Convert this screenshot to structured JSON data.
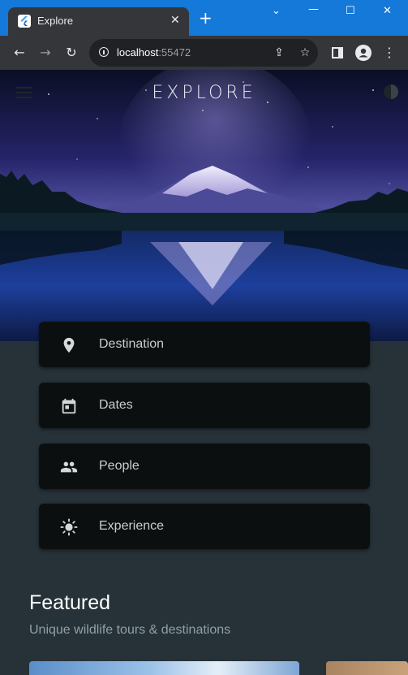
{
  "browser": {
    "tab_title": "Explore",
    "url_host": "localhost",
    "url_port": ":55472",
    "icons": [
      "flutter-logo",
      "close",
      "plus",
      "minimize",
      "maximize",
      "close",
      "back-arrow",
      "forward-arrow",
      "reload",
      "info",
      "share",
      "star",
      "sidebar",
      "profile",
      "kebab"
    ]
  },
  "app": {
    "title": "EXPLORE",
    "options": [
      {
        "label": "Destination",
        "icon": "location-pin-icon"
      },
      {
        "label": "Dates",
        "icon": "calendar-icon"
      },
      {
        "label": "People",
        "icon": "people-icon"
      },
      {
        "label": "Experience",
        "icon": "sun-icon"
      }
    ],
    "featured": {
      "title": "Featured",
      "subtitle": "Unique wildlife tours & destinations"
    }
  },
  "colors": {
    "titlebar": "#1479d8",
    "chrome": "#35363a",
    "background": "#263238",
    "option_bg": "#0c0f10"
  }
}
